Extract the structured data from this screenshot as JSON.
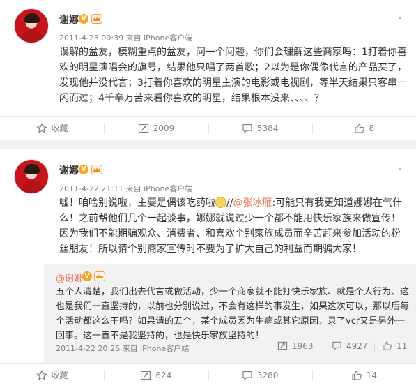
{
  "posts": [
    {
      "author": "谢娜",
      "verified_badge": "V",
      "meta": "2011-4-23 00:39 来自 iPhone客户端",
      "text": "误解的盆友，模糊重点的盆友，问一个问题，你们会理解这些商家吗：1打着你喜欢的明星演唱会的旗号，结果他只唱了两首歌；2以为是你偶像代言的产品买了，发现他并没代言；3打着你喜欢的明星主演的电影或电视剧，等半天结果只客串一闪而过；4千辛万苦来看你喜欢的明星，结果根本没来、、、、？",
      "actions": {
        "favorite": "收藏",
        "repost": "2009",
        "comment": "5384",
        "like": "8"
      }
    },
    {
      "author": "谢娜",
      "verified_badge": "V",
      "meta": "2011-4-22 21:11 来自 iPhone客户端",
      "text_before": "嘘！咱啥别说啦，主要是偶该吃药啦",
      "text_sep": "//",
      "mention": "@张冰雁",
      "text_after": ":可能只有我更知道娜娜在气什么！之前帮他们几个一起谈事，娜娜就说过少一个都不能用快乐家族来做宣传！因为我们不能期骗观众、消费者、和喜欢个别家族成员而辛苦赶来参加活动的粉丝朋友！所以请个别商家宣传时不要为了扩大自己的利益而期骗大家！",
      "repost": {
        "author": "@谢娜",
        "verified_badge": "V",
        "text": "五个人清楚，我们出去代言或做活动，少一个商家就不能打快乐家族、就是个人行为、这也是我们一直坚持的，以前也分别说过，不会有这样的事发生，如果这次可以，那以后每个活动都这么干吗？如果请的五个，某个成员因为生病或其它原因，录了vcr又是另外一回事。这一直不是我坚持的，也是快乐家族坚持的！",
        "meta": "2011-4-22 20:26 来自 iPhone客户端",
        "repost_count": "1963",
        "comment_count": "4927",
        "like_count": "11"
      },
      "actions": {
        "favorite": "收藏",
        "repost": "624",
        "comment": "3280",
        "like": "14"
      }
    }
  ],
  "colors": {
    "accent": "#eb7350",
    "verified": "#f5a623",
    "muted": "#808080",
    "repost_bg": "#f2f2f5"
  },
  "icons": [
    "star-icon",
    "repost-icon",
    "comment-icon",
    "thumbs-up-icon",
    "chevron-down-icon",
    "crown-icon"
  ]
}
